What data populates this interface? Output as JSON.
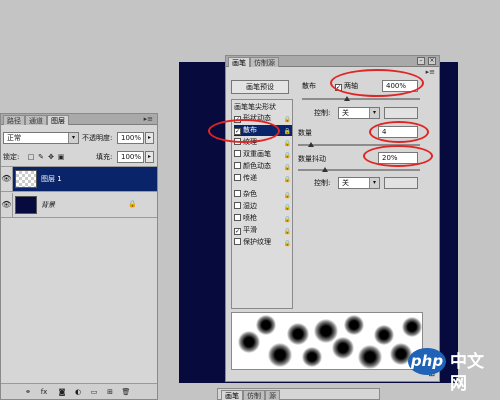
{
  "layers_panel": {
    "tabs": [
      "路径",
      "通道",
      "图层"
    ],
    "blend_mode": "正常",
    "opacity_label": "不透明度:",
    "opacity_value": "100%",
    "lock_label": "锁定:",
    "fill_label": "填充:",
    "fill_value": "100%",
    "layers": [
      {
        "name": "图层 1",
        "visible": true,
        "selected": true
      },
      {
        "name": "背景",
        "visible": true,
        "selected": false,
        "locked": true
      }
    ]
  },
  "brushes_panel": {
    "tabs": [
      "画笔",
      "仿制源"
    ],
    "presets_button": "画笔预设",
    "options": [
      {
        "label": "画笔笔尖形状",
        "header": true
      },
      {
        "label": "形状动态",
        "checked": true
      },
      {
        "label": "散布",
        "checked": true,
        "selected": true
      },
      {
        "label": "纹理",
        "checked": false
      },
      {
        "label": "双重画笔",
        "checked": false
      },
      {
        "label": "颜色动态",
        "checked": false
      },
      {
        "label": "传递",
        "checked": false
      },
      {
        "label": "杂色",
        "checked": false
      },
      {
        "label": "湿边",
        "checked": false
      },
      {
        "label": "喷枪",
        "checked": false
      },
      {
        "label": "平滑",
        "checked": true
      },
      {
        "label": "保护纹理",
        "checked": false
      }
    ],
    "scatter": {
      "label": "散布",
      "both_axes_label": "两轴",
      "both_axes_checked": true,
      "value": "400%",
      "control_label": "控制:",
      "control_value": "关"
    },
    "count": {
      "label": "数量",
      "value": "4"
    },
    "count_jitter": {
      "label": "数量抖动",
      "value": "20%",
      "control_label": "控制:",
      "control_value": "关"
    }
  },
  "bottom_panel": {
    "tabs": [
      "画笔",
      "仿制",
      "源"
    ]
  },
  "watermark": {
    "badge": "php",
    "text": "中文网"
  },
  "colors": {
    "canvas": "#070a3c",
    "selection": "#0a246a",
    "annotation": "#e02525"
  }
}
